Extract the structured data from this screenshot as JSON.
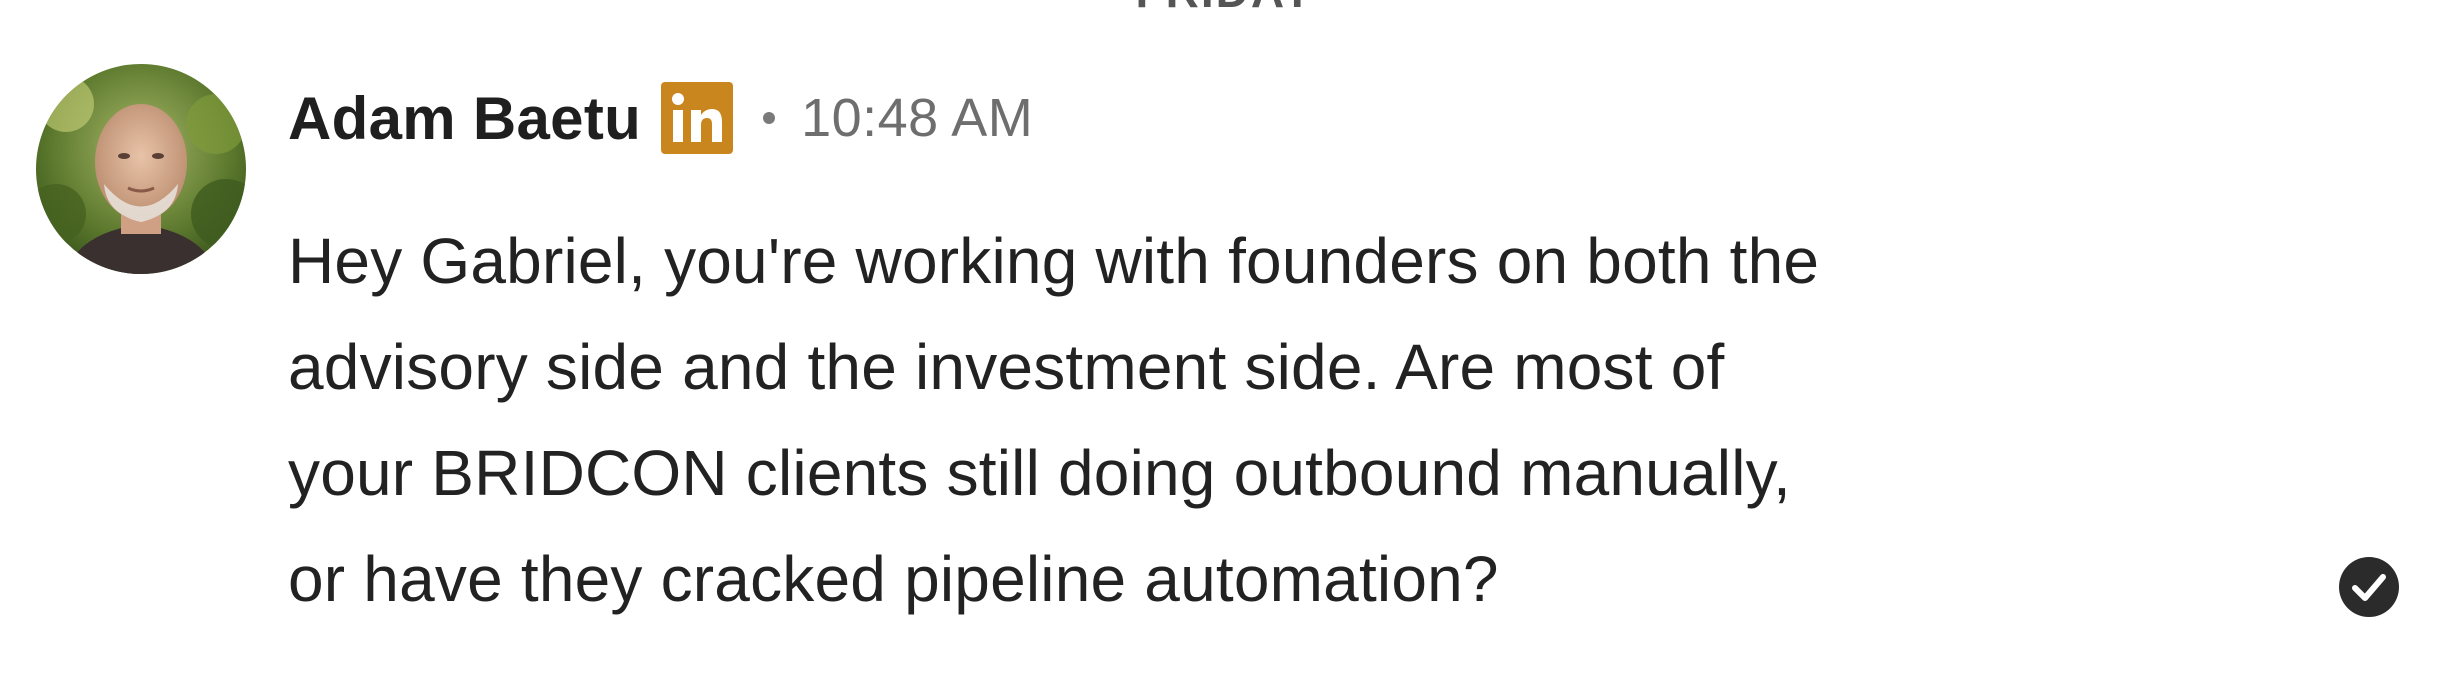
{
  "day_divider": {
    "label": "FRIDAY"
  },
  "message": {
    "sender_name": "Adam Baetu",
    "sender_badge_icon": "linkedin-icon",
    "separator": "·",
    "timestamp": "10:48 AM",
    "body_lines": [
      "Hey Gabriel, you're working with founders on both the",
      "advisory side and the investment side. Are most of",
      "your BRIDCON clients still doing outbound manually,",
      "or have they cracked pipeline automation?"
    ],
    "status_icon": "read-check-icon"
  },
  "colors": {
    "linkedin_badge": "#C9861F",
    "name_text": "#1f1f1f",
    "timestamp_text": "#6e6e6e",
    "body_text": "#222222",
    "check_circle": "#2b2b2b"
  }
}
